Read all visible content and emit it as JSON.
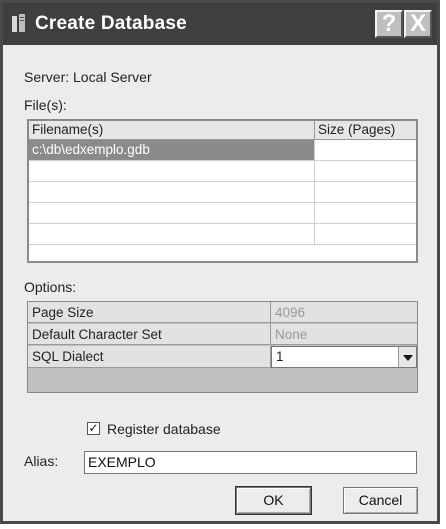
{
  "window": {
    "title": "Create Database",
    "help_button": "?",
    "close_button": "X"
  },
  "server_label": "Server: Local Server",
  "files": {
    "label": "File(s):",
    "columns": [
      "Filename(s)",
      "Size (Pages)"
    ],
    "rows": [
      {
        "filename": "c:\\db\\edxemplo.gdb",
        "size": ""
      },
      {
        "filename": "",
        "size": ""
      },
      {
        "filename": "",
        "size": ""
      },
      {
        "filename": "",
        "size": ""
      },
      {
        "filename": "",
        "size": ""
      }
    ]
  },
  "options": {
    "label": "Options:",
    "rows": [
      {
        "name": "Page Size",
        "value": "4096"
      },
      {
        "name": "Default Character Set",
        "value": "None"
      },
      {
        "name": "SQL Dialect",
        "value": "1"
      }
    ]
  },
  "register": {
    "label": "Register database",
    "checked": true
  },
  "alias": {
    "label": "Alias:",
    "value": "EXEMPLO"
  },
  "buttons": {
    "ok": "OK",
    "cancel": "Cancel"
  }
}
